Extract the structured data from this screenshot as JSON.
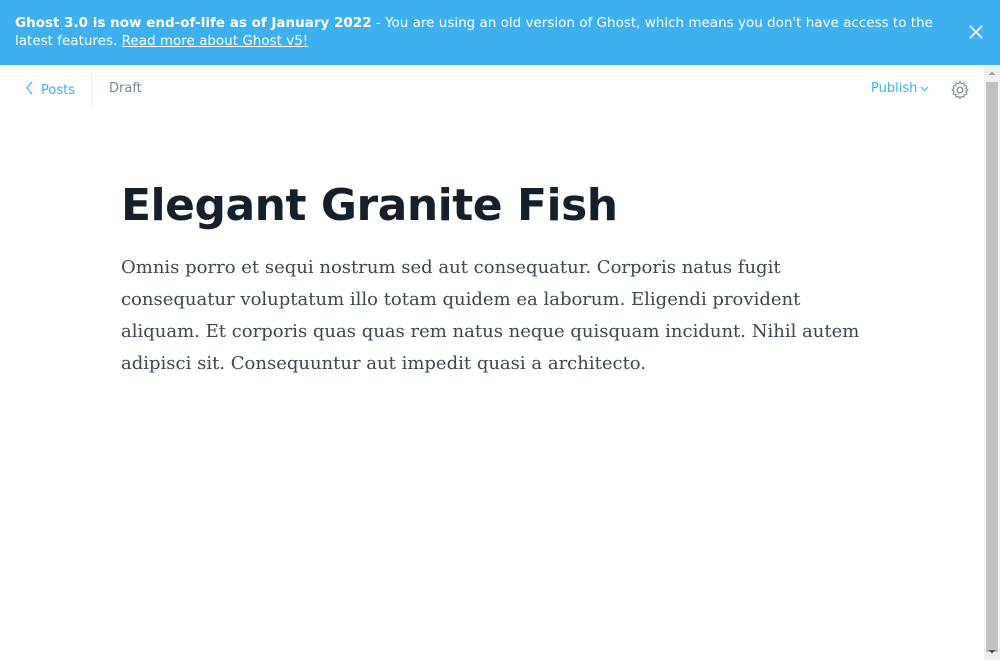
{
  "banner": {
    "headline": "Ghost 3.0 is now end-of-life as of January 2022",
    "message": " - You are using an old version of Ghost, which means you don't have access to the latest features. ",
    "link_text": "Read more about Ghost v5!",
    "close_icon": "close-icon",
    "background_color": "#3eb0ef"
  },
  "toolbar": {
    "back_label": "Posts",
    "back_icon": "chevron-left-icon",
    "status": "Draft",
    "publish_label": "Publish",
    "publish_icon": "chevron-down-icon",
    "settings_icon": "gear-icon"
  },
  "post": {
    "title": "Elegant Granite Fish",
    "body": "Omnis porro et sequi nostrum sed aut consequatur. Corporis natus fugit consequatur voluptatum illo totam quidem ea laborum. Eligendi provident aliquam. Et corporis quas quas rem natus neque quisquam incidunt. Nihil autem adipisci sit. Consequuntur aut impedit quasi a architecto."
  },
  "colors": {
    "accent": "#3eb0ef",
    "title_text": "#15212a",
    "body_text": "#3c484e",
    "muted_text": "#738a94"
  }
}
